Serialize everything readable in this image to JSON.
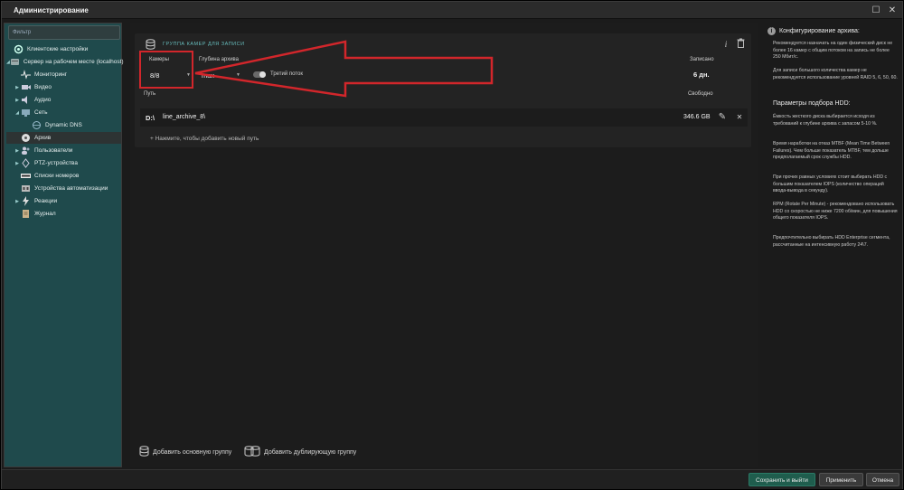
{
  "window": {
    "title": "Администрирование"
  },
  "sidebar": {
    "filter_placeholder": "Фильтр",
    "items": [
      {
        "label": "Клиентские настройки",
        "icon": "client-settings-icon"
      },
      {
        "label": "Сервер на рабочем месте (localhost)",
        "icon": "server-icon"
      },
      {
        "label": "Мониторинг",
        "icon": "monitoring-icon"
      },
      {
        "label": "Видео",
        "icon": "video-icon"
      },
      {
        "label": "Аудио",
        "icon": "audio-icon"
      },
      {
        "label": "Сеть",
        "icon": "network-icon"
      },
      {
        "label": "Dynamic DNS",
        "icon": "dns-icon"
      },
      {
        "label": "Архив",
        "icon": "archive-icon"
      },
      {
        "label": "Пользователи",
        "icon": "users-icon"
      },
      {
        "label": "PTZ-устройства",
        "icon": "ptz-icon"
      },
      {
        "label": "Списки номеров",
        "icon": "number-lists-icon"
      },
      {
        "label": "Устройства автоматизации",
        "icon": "automation-icon"
      },
      {
        "label": "Реакции",
        "icon": "reactions-icon"
      },
      {
        "label": "Журнал",
        "icon": "journal-icon"
      }
    ]
  },
  "group": {
    "header": "ГРУППА КАМЕР ДЛЯ ЗАПИСИ",
    "cameras_label": "Камеры",
    "cameras_value": "8/8",
    "depth_label": "Глубина архива",
    "depth_value": "max",
    "third_stream_label": "Третий поток",
    "recorded_label": "Записано",
    "recorded_value": "6 дн.",
    "path_label": "Путь",
    "free_label": "Свободно",
    "drive": "D:\\",
    "path_value": "line_archive_8\\",
    "free_value": "346.6 GB",
    "add_path": "+ Нажмите, чтобы добавить новый путь"
  },
  "bottom": {
    "add_main": "Добавить основную группу",
    "add_duplicate": "Добавить дублирующую группу"
  },
  "info": {
    "title": "Конфигурирование архива:",
    "p1": "Рекомендуется назначать на один физический диск не более 16 камер с общим потоком на запись не более 250 Мбит/с.",
    "p2": "Для записи большого количества камер не рекомендуется использование уровней RAID 5, 6, 50, 60.",
    "title2": "Параметры подбора HDD:",
    "p3": "Ёмкость жесткого диска выбирается исходя из требований к глубине архива с запасом 5-10 %.",
    "p4": "Время наработки на отказ MTBF (Mean Time Between Failures). Чем больше показатель MTBF, тем дольше предполагаемый срок службы HDD.",
    "p5": "При прочих равных условиях стоит выбирать HDD с большим показателем IOPS (количество операций ввода-вывода в секунду).",
    "p6": "RPM (Rotate Per Minute) - рекомендовано использовать HDD со скоростью не ниже 7200 об/мин, для повышения общего показателя IOPS.",
    "p7": "Предпочтительно выбирать HDD Enterprise сегмента, рассчитанные на интенсивную работу 24\\7."
  },
  "footer": {
    "save_exit": "Сохранить и выйти",
    "apply": "Применить",
    "cancel": "Отмена"
  },
  "colors": {
    "accent": "#d2262b",
    "sidebar_bg": "#1f4a4c",
    "primary_button": "#1f5d4d"
  }
}
